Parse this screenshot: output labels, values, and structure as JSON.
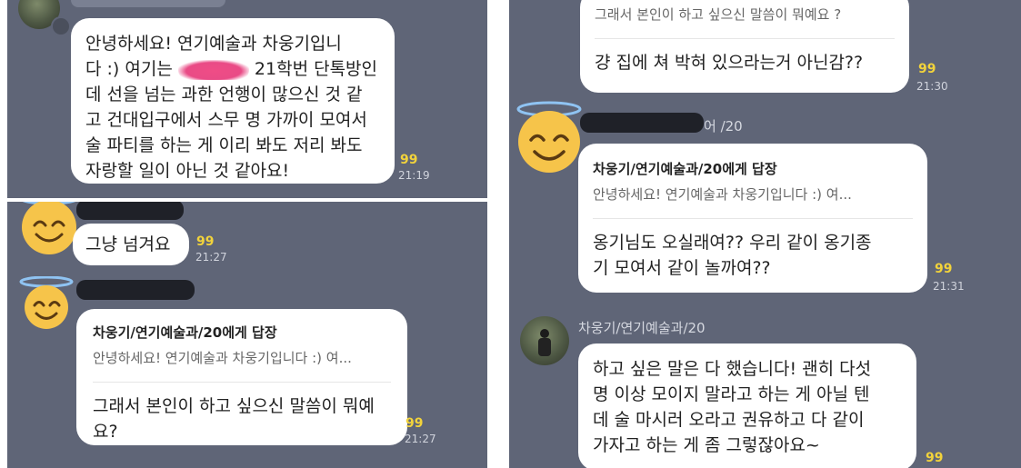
{
  "left": {
    "msg1": {
      "lines": [
        "안녕하세요! 연기예술과 차웅기입니",
        "다 :) 여기는",
        "21학번 단톡방인",
        "데 선을 넘는 과한 언행이 많으신 것 같",
        "고 건대입구에서 스무 명 가까이 모여서",
        "술 파티를 하는 게 이리 봐도 저리 봐도",
        "자랑할 일이 아닌 것 같아요!"
      ],
      "count": "99",
      "time": "21:19"
    },
    "msg2": {
      "text": "그냥 넘겨요",
      "count": "99",
      "time": "21:27"
    },
    "msg3": {
      "reply_to": "차웅기/연기예술과/20에게 답장",
      "quote": "안녕하세요! 연기예술과 차웅기입니다 :) 여...",
      "lines": [
        "그래서 본인이 하고 싶으신 말씀이 뭐예",
        "요?"
      ],
      "count": "99",
      "time": "21:27"
    }
  },
  "right": {
    "top_msg": {
      "line1": "그래서 본인이 하고 싶으신 말씀이 뭐예요 ?",
      "line2": "걍 집에 쳐 박혀 있으라는거 아닌감??",
      "count": "99",
      "time": "21:30"
    },
    "sender_suffix": "어 /20",
    "reply_msg": {
      "reply_to": "차웅기/연기예술과/20에게 답장",
      "quote": "안녕하세요! 연기예술과 차웅기입니다 :) 여...",
      "lines": [
        "옹기님도 오실래여?? 우리 같이 옹기종",
        "기 모여서 같이 놀까여??"
      ],
      "count": "99",
      "time": "21:31"
    },
    "last_sender": "차웅기/연기예술과/20",
    "last_msg": {
      "lines": [
        "하고 싶은 말은 다 했습니다! 괜히 다섯",
        "명 이상 모이지 말라고 하는 게 아닐 텐",
        "데 술 마시러 오라고 권유하고 다 같이",
        "가자고 하는 게 좀 그렇잖아요~"
      ],
      "count": "99"
    }
  }
}
